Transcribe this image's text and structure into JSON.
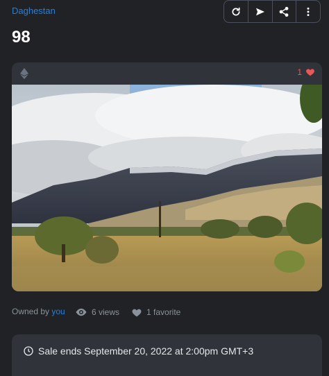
{
  "collection": {
    "name": "Daghestan"
  },
  "item": {
    "title": "98"
  },
  "toolbar": {
    "buttons": [
      {
        "icon": "refresh-icon"
      },
      {
        "icon": "send-icon"
      },
      {
        "icon": "share-icon"
      },
      {
        "icon": "more-vertical-icon"
      }
    ]
  },
  "card": {
    "chain_icon": "ethereum-icon",
    "favorite_count": "1",
    "image_alt": "Mountain landscape with clouds and autumn meadow"
  },
  "meta": {
    "owned_by_prefix": "Owned by",
    "owner": "you",
    "views": "6 views",
    "favorites": "1 favorite"
  },
  "sale": {
    "text": "Sale ends September 20, 2022 at 2:00pm GMT+3"
  },
  "colors": {
    "background": "#202225",
    "card": "#303339",
    "link": "#2081e2",
    "heart": "#eb5757",
    "muted": "#8a939b"
  }
}
